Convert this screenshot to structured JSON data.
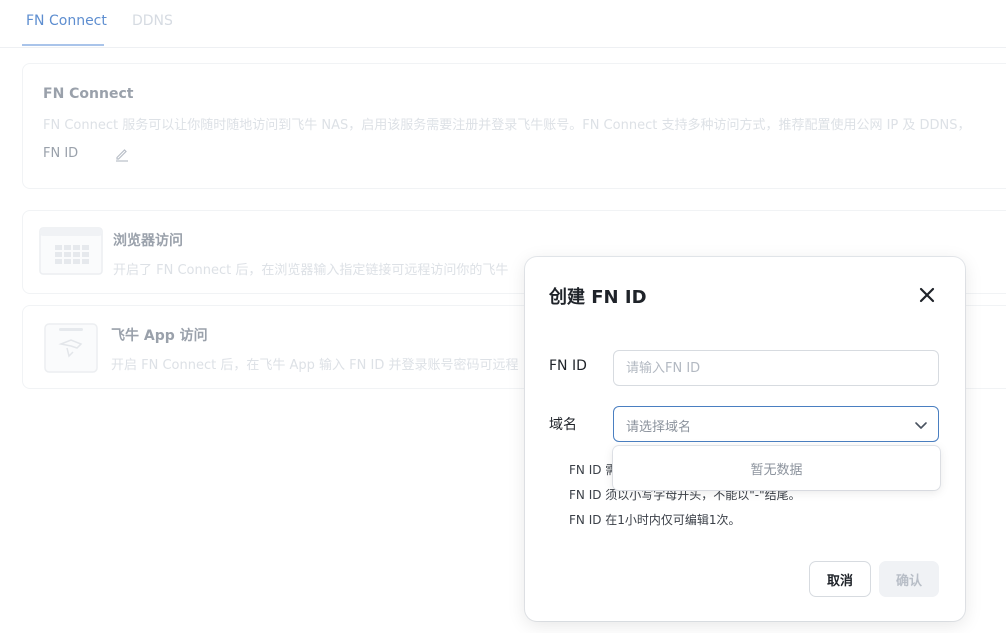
{
  "tabs": [
    {
      "label": "FN Connect",
      "active": true
    },
    {
      "label": "DDNS",
      "active": false
    }
  ],
  "fn_connect": {
    "title": "FN Connect",
    "description": "FN Connect 服务可以让你随时随地访问到飞牛 NAS，启用该服务需要注册并登录飞牛账号。FN Connect 支持多种访问方式，推荐配置使用公网 IP 及 DDNS，",
    "fnid_label": "FN ID"
  },
  "services": [
    {
      "title": "浏览器访问",
      "description": "开启了 FN Connect 后，在浏览器输入指定链接可远程访问你的飞牛",
      "icon": "browser-icon"
    },
    {
      "title": "飞牛 App 访问",
      "description": "开启 FN Connect 后，在飞牛 App 输入 FN ID 并登录账号密码可远程",
      "icon": "phone-app-icon"
    }
  ],
  "dialog": {
    "title": "创建 FN ID",
    "fnid_label": "FN ID",
    "fnid_placeholder": "请输入FN ID",
    "domain_label": "域名",
    "domain_placeholder": "请选择域名",
    "hints": [
      "FN ID 需",
      "FN ID 须以小写字母开头，不能以\"-\"结尾。",
      "FN ID 在1小时内仅可编辑1次。"
    ],
    "cancel_label": "取消",
    "confirm_label": "确认"
  },
  "dropdown": {
    "empty_text": "暂无数据"
  },
  "colors": {
    "accent": "#4a7fc1",
    "tab_active": "#5e8ed0",
    "muted_text": "#dde1e6"
  }
}
